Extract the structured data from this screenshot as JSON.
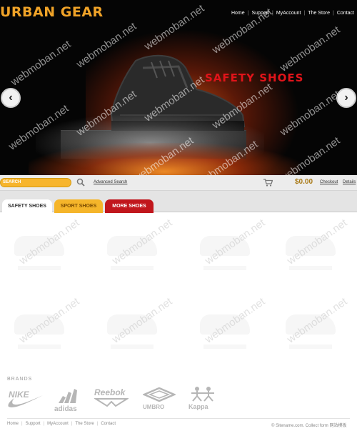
{
  "site": {
    "logo": "URBAN GEAR"
  },
  "top_nav": [
    "Home",
    "Support",
    "MyAccount",
    "The Store",
    "Contact"
  ],
  "hero": {
    "title": "SAFETY SHOES"
  },
  "watermark": "webmoban.net",
  "toolbar": {
    "search_placeholder": "SEARCH",
    "advanced_search": "Advanced Search",
    "cart_total": "$0.00",
    "checkout": "Checkout",
    "details": "Details"
  },
  "tabs": [
    "SAFETY SHOES",
    "SPORT SHOES",
    "MORE SHOES"
  ],
  "brands": {
    "label": "BRANDS",
    "items": [
      "NIKE",
      "adidas",
      "Reebok",
      "UMBRO",
      "Kappa"
    ]
  },
  "footer": {
    "nav": [
      "Home",
      "Support",
      "MyAccount",
      "The Store",
      "Contact"
    ],
    "copyright": "© Sitename.com. Collect form 网站模板"
  },
  "colors": {
    "accent_orange": "#f5b52a",
    "accent_red": "#c1161c",
    "hero_title": "#e0141a",
    "logo": "#f0a328"
  }
}
